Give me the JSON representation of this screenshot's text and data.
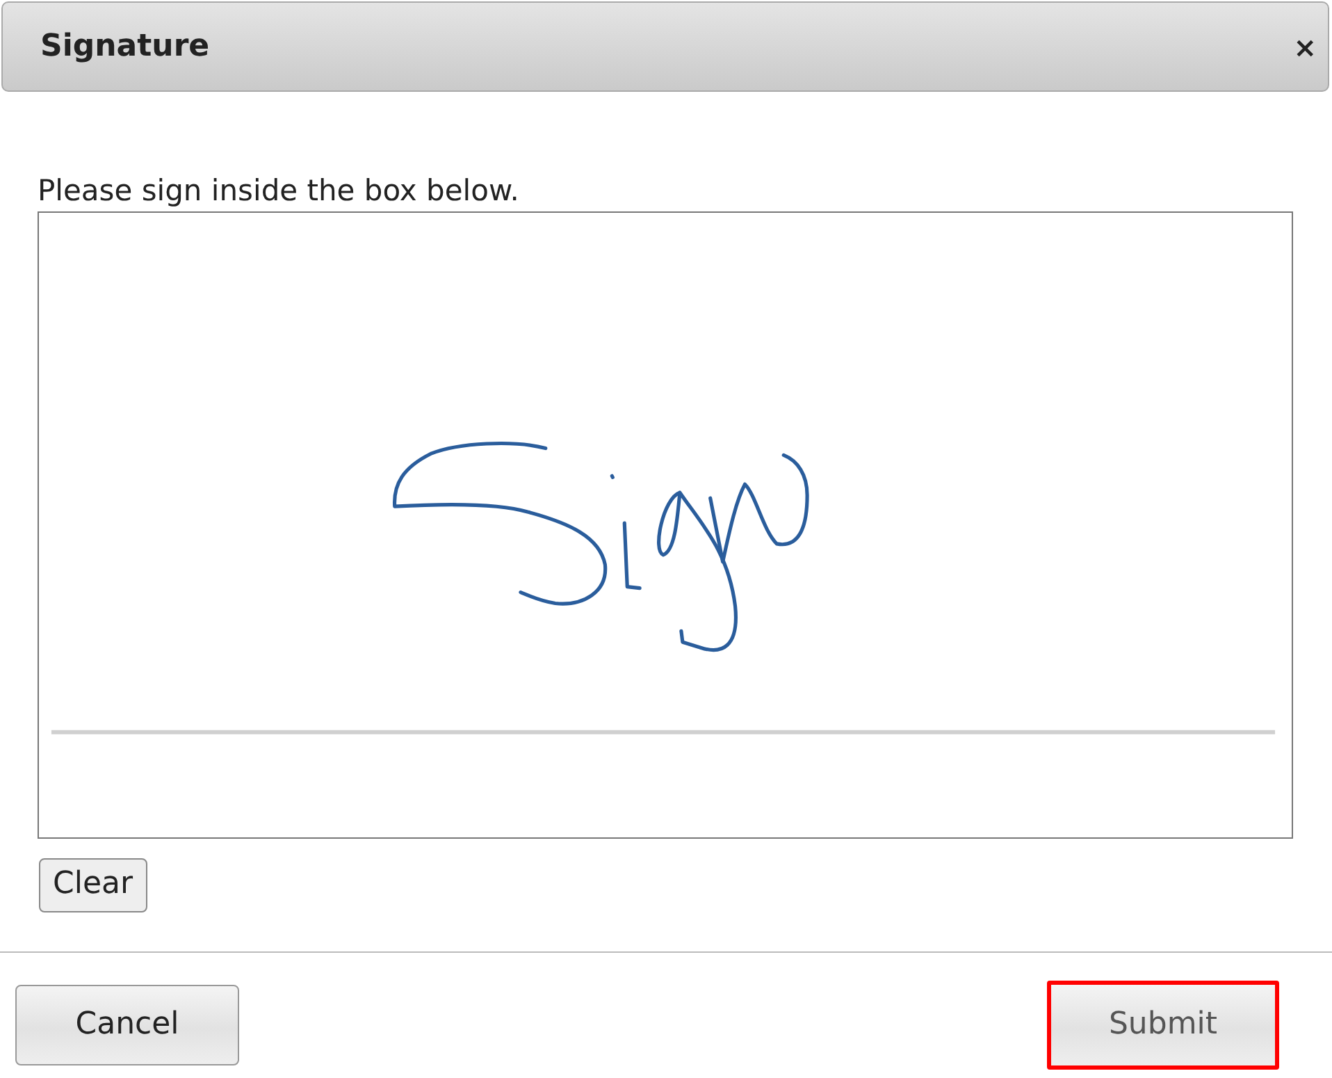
{
  "dialog": {
    "title": "Signature",
    "close": "×"
  },
  "prompt": "Please sign inside the box below.",
  "clear_button": "Clear",
  "buttons": [
    {
      "label": "Cancel",
      "disabled": false,
      "highlighted": false
    },
    {
      "label": "Submit",
      "disabled": true,
      "highlighted": true
    }
  ]
}
